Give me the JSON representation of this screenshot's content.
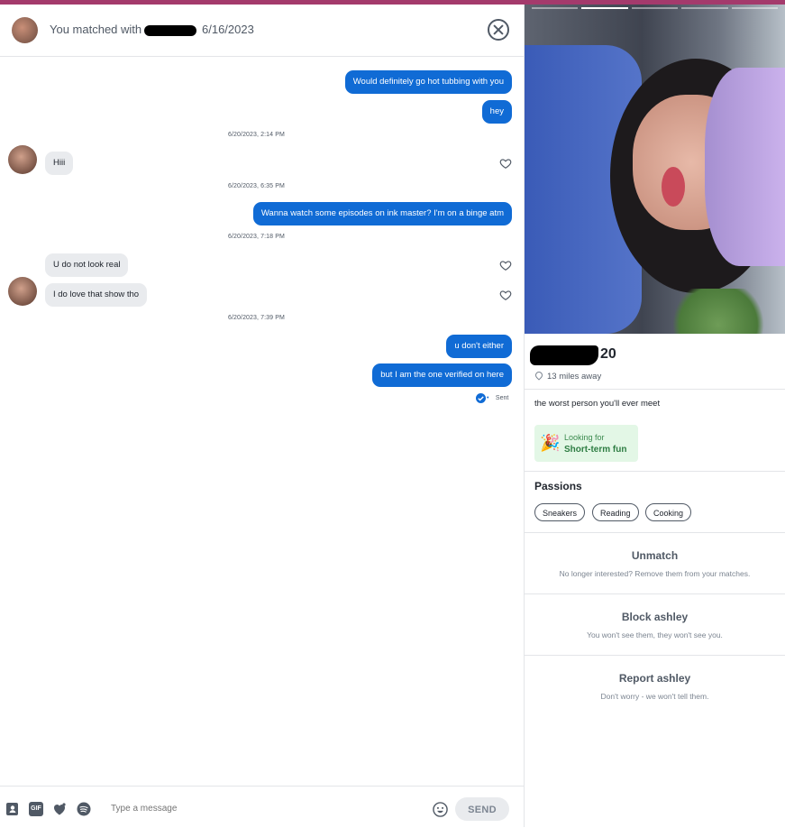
{
  "header": {
    "matched_text": "You matched with",
    "match_date": "6/16/2023"
  },
  "messages": {
    "m1": "Would definitely go hot tubbing with you",
    "m2": "hey",
    "ts1": "6/20/2023, 2:14 PM",
    "m3": "Hiii",
    "ts2": "6/20/2023, 6:35 PM",
    "m4": "Wanna watch some episodes on ink master? I'm on a binge atm",
    "ts3": "6/20/2023, 7:18 PM",
    "m5": "U do not look real",
    "m6": "I do love that show tho",
    "ts4": "6/20/2023, 7:39 PM",
    "m7": "u don't either",
    "m8": "but I am the one verified on here",
    "sent_status": "Sent"
  },
  "composer": {
    "placeholder": "Type a message",
    "send_label": "SEND",
    "gif_label": "GIF"
  },
  "profile": {
    "age": "20",
    "distance": "13 miles away",
    "bio": "the worst person you'll ever meet",
    "looking_for_label": "Looking for",
    "looking_for_value": "Short-term fun",
    "passions_title": "Passions",
    "passions": [
      "Sneakers",
      "Reading",
      "Cooking"
    ],
    "photo_count": 5,
    "active_photo": 2
  },
  "actions": {
    "unmatch_title": "Unmatch",
    "unmatch_sub": "No longer interested? Remove them from your matches.",
    "block_title": "Block ashley",
    "block_sub": "You won't see them, they won't see you.",
    "report_title": "Report ashley",
    "report_sub": "Don't worry - we won't tell them."
  },
  "colors": {
    "accent_bar": "#a43a6c",
    "outgoing_bubble": "#106bd5",
    "incoming_bubble": "#e9ebee",
    "looking_for_bg": "#e3f7e6"
  }
}
